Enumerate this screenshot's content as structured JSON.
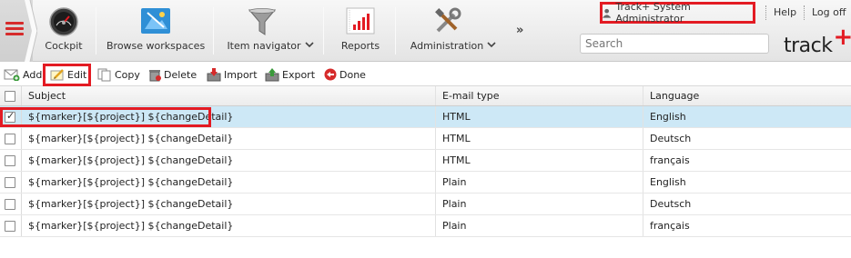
{
  "nav": {
    "items": [
      {
        "label": "Cockpit",
        "icon": "speedometer-icon"
      },
      {
        "label": "Browse workspaces",
        "icon": "workspace-icon"
      },
      {
        "label": "Item navigator",
        "icon": "filter-funnel-icon"
      },
      {
        "label": "Reports",
        "icon": "bar-chart-icon"
      },
      {
        "label": "Administration",
        "icon": "tools-icon"
      }
    ],
    "more": "»",
    "user": "Track+ System Administrator",
    "help": "Help",
    "logoff": "Log off",
    "search_placeholder": "Search",
    "brand": "track",
    "brand_plus": "+"
  },
  "toolbar": {
    "add": "Add",
    "edit": "Edit",
    "copy": "Copy",
    "delete": "Delete",
    "import": "Import",
    "export": "Export",
    "done": "Done"
  },
  "table": {
    "columns": [
      "Subject",
      "E-mail type",
      "Language"
    ],
    "rows": [
      {
        "selected": true,
        "subject": "${marker}[${project}] ${changeDetail}",
        "type": "HTML",
        "language": "English"
      },
      {
        "selected": false,
        "subject": "${marker}[${project}] ${changeDetail}",
        "type": "HTML",
        "language": "Deutsch"
      },
      {
        "selected": false,
        "subject": "${marker}[${project}] ${changeDetail}",
        "type": "HTML",
        "language": "français"
      },
      {
        "selected": false,
        "subject": "${marker}[${project}] ${changeDetail}",
        "type": "Plain",
        "language": "English"
      },
      {
        "selected": false,
        "subject": "${marker}[${project}] ${changeDetail}",
        "type": "Plain",
        "language": "Deutsch"
      },
      {
        "selected": false,
        "subject": "${marker}[${project}] ${changeDetail}",
        "type": "Plain",
        "language": "français"
      }
    ]
  },
  "colors": {
    "accent": "#e31b23",
    "selection": "#cde8f6"
  }
}
